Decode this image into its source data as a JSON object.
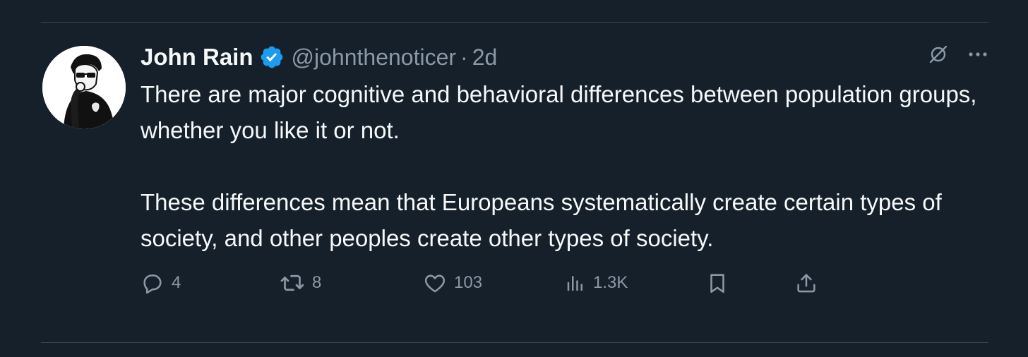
{
  "tweet": {
    "author": {
      "name": "John Rain",
      "handle": "@johnthenoticer",
      "verified": true
    },
    "separator": "·",
    "time": "2d",
    "text": [
      "There are major cognitive and behavioral differences between population groups, whether you like it or not.",
      "These differences mean that Europeans systematically create certain types of society, and other peoples create other types of society."
    ],
    "actions": {
      "replies": "4",
      "reposts": "8",
      "likes": "103",
      "views": "1.3K"
    }
  },
  "icons": {
    "verified": "verified-badge-icon",
    "grok": "grok-icon",
    "more": "more-icon",
    "reply": "reply-icon",
    "repost": "repost-icon",
    "like": "heart-icon",
    "views": "views-icon",
    "bookmark": "bookmark-icon",
    "share": "share-icon"
  },
  "colors": {
    "background": "#15202b",
    "text": "#f7f9f9",
    "secondary": "#8b98a5",
    "verified": "#1d9bf0",
    "divider": "#38444d"
  }
}
